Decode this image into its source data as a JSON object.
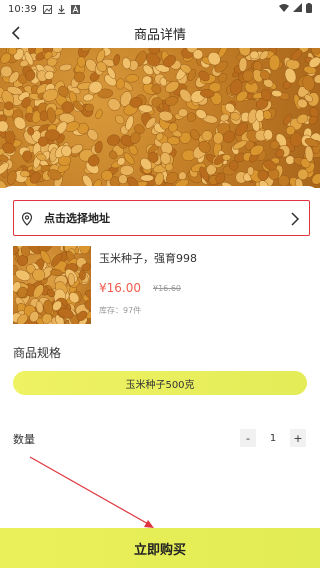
{
  "status_bar": {
    "time": "10:39"
  },
  "header": {
    "title": "商品详情"
  },
  "address": {
    "label": "点击选择地址"
  },
  "product": {
    "name": "玉米种子，强育998",
    "price": "¥16.00",
    "original_price": "¥16.60",
    "stock": "库存：97件"
  },
  "spec": {
    "title": "商品规格",
    "options": [
      "玉米种子500克"
    ]
  },
  "quantity": {
    "label": "数量",
    "minus": "-",
    "value": "1",
    "plus": "+"
  },
  "buy_button": {
    "label": "立即购买"
  },
  "colors": {
    "accent_yellow": "#e8ef5a",
    "price_red": "#ef5b4c",
    "outline_red": "#e0353e"
  }
}
